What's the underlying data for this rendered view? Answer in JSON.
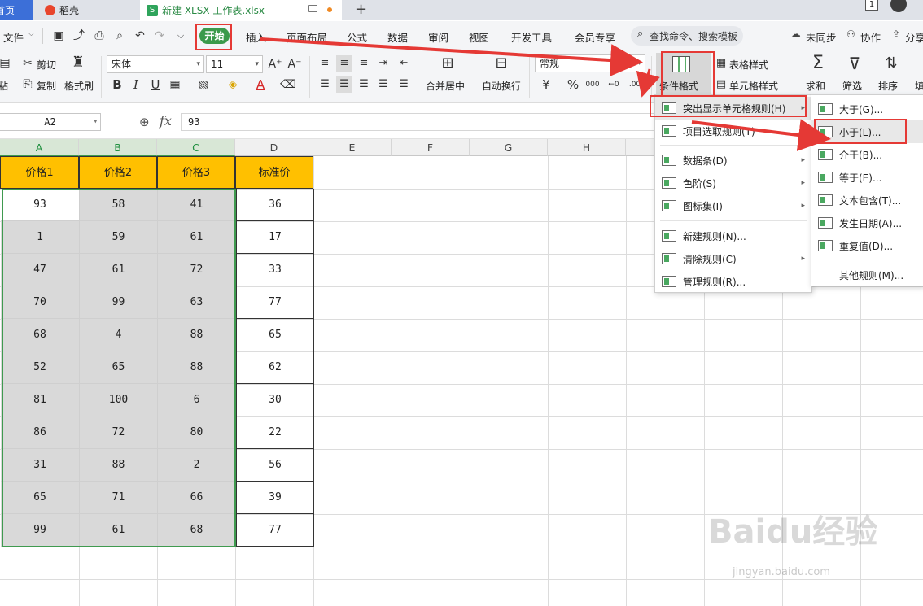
{
  "tabs": [
    {
      "label": "首页"
    },
    {
      "label": "稻壳"
    },
    {
      "label": "新建 XLSX 工作表.xlsx"
    }
  ],
  "new_tab_symbol": "+",
  "window": {
    "page_badge": "1"
  },
  "menu": {
    "file": "文件",
    "items": [
      "开始",
      "插入",
      "页面布局",
      "公式",
      "数据",
      "审阅",
      "视图",
      "开发工具",
      "会员专享"
    ],
    "search": "查找命令、搜索模板",
    "right": [
      "未同步",
      "协作",
      "分享"
    ]
  },
  "ribbon": {
    "cut": "剪切",
    "paste_partial": "粘",
    "copy": "复制",
    "format_painter": "格式刷",
    "font_name": "宋体",
    "font_size": "11",
    "merge_center": "合并居中",
    "wrap_text": "自动换行",
    "number_format": "常规",
    "conditional_format": "条件格式",
    "table_style": "表格样式",
    "cell_style": "单元格样式",
    "sum": "求和",
    "filter": "筛选",
    "sort": "排序",
    "fill_partial": "填",
    "bold": "B",
    "italic": "I",
    "underline": "U",
    "font_color_letter": "A",
    "yen": "¥",
    "percent": "%"
  },
  "formula_bar": {
    "name_box": "A2",
    "fx": "fx",
    "value": "93"
  },
  "sheet": {
    "columns": [
      "A",
      "B",
      "C",
      "D",
      "E",
      "F",
      "G",
      "H"
    ],
    "headers": [
      "价格1",
      "价格2",
      "价格3",
      "标准价"
    ],
    "rows": [
      [
        "93",
        "58",
        "41",
        "36"
      ],
      [
        "1",
        "59",
        "61",
        "17"
      ],
      [
        "47",
        "61",
        "72",
        "33"
      ],
      [
        "70",
        "99",
        "63",
        "77"
      ],
      [
        "68",
        "4",
        "88",
        "65"
      ],
      [
        "52",
        "65",
        "88",
        "62"
      ],
      [
        "81",
        "100",
        "6",
        "30"
      ],
      [
        "86",
        "72",
        "80",
        "22"
      ],
      [
        "31",
        "88",
        "2",
        "56"
      ],
      [
        "65",
        "71",
        "66",
        "39"
      ],
      [
        "99",
        "61",
        "68",
        "77"
      ]
    ]
  },
  "cf_menu": {
    "items": [
      {
        "label": "突出显示单元格规则(H)",
        "has_sub": true
      },
      {
        "label": "项目选取规则(T)",
        "has_sub": true
      },
      {
        "label": "数据条(D)",
        "has_sub": true
      },
      {
        "label": "色阶(S)",
        "has_sub": true
      },
      {
        "label": "图标集(I)",
        "has_sub": true
      },
      {
        "label": "新建规则(N)...",
        "has_sub": false
      },
      {
        "label": "清除规则(C)",
        "has_sub": true
      },
      {
        "label": "管理规则(R)...",
        "has_sub": false
      }
    ]
  },
  "highlight_submenu": {
    "items": [
      "大于(G)...",
      "小于(L)...",
      "介于(B)...",
      "等于(E)...",
      "文本包含(T)...",
      "发生日期(A)...",
      "重复值(D)...",
      "其他规则(M)..."
    ]
  },
  "watermark": {
    "text": "Baidu经验",
    "url": "jingyan.baidu.com"
  },
  "colors": {
    "accent_green": "#3f9a4f",
    "header_fill": "#ffc000",
    "annotation_red": "#e53935"
  }
}
